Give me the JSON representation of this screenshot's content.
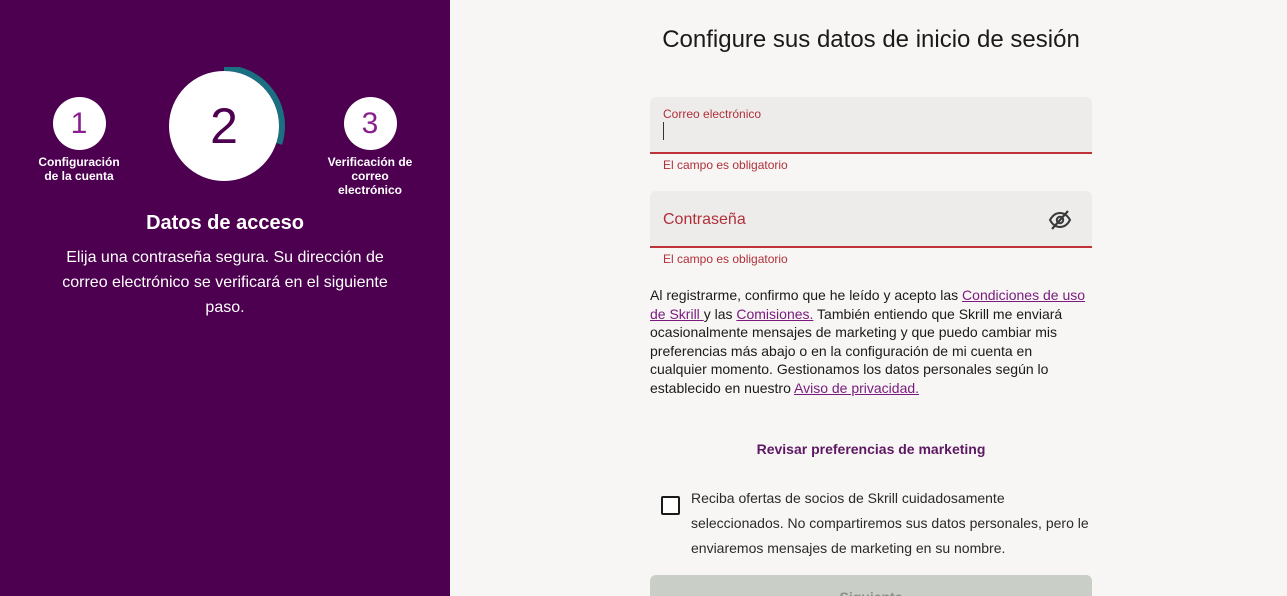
{
  "progress": {
    "steps": [
      {
        "number": "1",
        "label": "Configuración de la cuenta"
      },
      {
        "number": "2",
        "label": ""
      },
      {
        "number": "3",
        "label": "Verificación de correo electrónico"
      }
    ],
    "current_step_progress": 0.3,
    "accent_color": "#1a6f80"
  },
  "left": {
    "title": "Datos de acceso",
    "description": "Elija una contraseña segura. Su dirección de correo electrónico se verificará en el siguiente paso."
  },
  "form": {
    "title": "Configure sus datos de inicio de sesión",
    "email": {
      "label": "Correo electrónico",
      "value": "",
      "error": "El campo es obligatorio"
    },
    "password": {
      "label": "Contraseña",
      "value": "",
      "error": "El campo es obligatorio"
    },
    "legal": {
      "part1": "Al registrarme, confirmo que he leído y acepto las ",
      "terms_link": "Condiciones de uso de Skrill ",
      "part2": "y las ",
      "fees_link": "Comisiones.",
      "part3": " También entiendo que Skrill me enviará ocasionalmente mensajes de marketing y que puedo cambiar mis preferencias más abajo o en la configuración de mi cuenta en cualquier momento. Gestionamos los datos personales según lo establecido en nuestro ",
      "privacy_link": "Aviso de privacidad."
    },
    "marketing_link": "Revisar preferencias de marketing",
    "partner_offers": {
      "label": "Reciba ofertas de socios de Skrill cuidadosamente seleccionados. No compartiremos sus datos personales, pero le enviaremos mensajes de marketing en su nombre.",
      "checked": false
    },
    "next_button": "Siguiente"
  },
  "colors": {
    "sidebar": "#4c004f",
    "error": "#b0303a",
    "link": "#7a1a7f"
  }
}
